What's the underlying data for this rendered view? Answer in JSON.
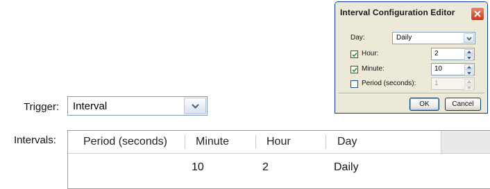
{
  "form": {
    "trigger_label": "Trigger:",
    "trigger_value": "Interval",
    "intervals_label": "Intervals:"
  },
  "grid": {
    "columns": [
      "Period (seconds)",
      "Minute",
      "Hour",
      "Day"
    ],
    "rows": [
      {
        "period": "",
        "minute": "10",
        "hour": "2",
        "day": "Daily"
      }
    ]
  },
  "dialog": {
    "title": "Interval Configuration Editor",
    "day_label": "Day:",
    "day_value": "Daily",
    "hour_label": "Hour:",
    "hour_checked": true,
    "hour_value": "2",
    "minute_label": "Minute:",
    "minute_checked": true,
    "minute_value": "10",
    "period_label": "Period (seconds):",
    "period_checked": false,
    "period_value": "1",
    "ok_label": "OK",
    "cancel_label": "Cancel"
  },
  "colors": {
    "title_close": "#c8391c",
    "border_blue": "#7f9db9",
    "dialog_bg": "#ece9d8"
  }
}
